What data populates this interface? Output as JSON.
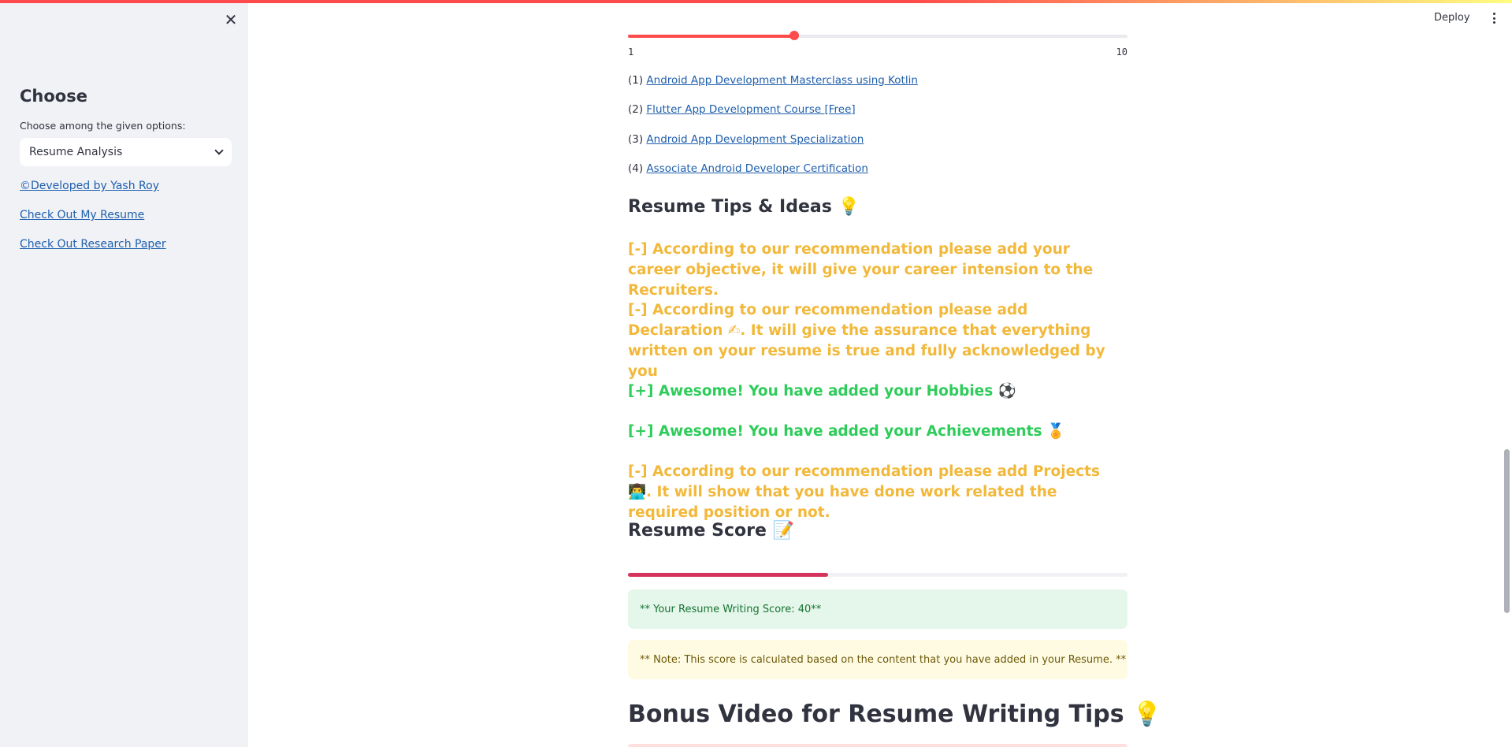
{
  "header": {
    "deploy_label": "Deploy",
    "menu_icon": "kebab-menu-icon"
  },
  "sidebar": {
    "close_icon": "close-icon",
    "heading": "Choose",
    "select_label": "Choose among the given options:",
    "select_value": "Resume Analysis",
    "links": [
      "©Developed by Yash Roy",
      "Check Out My Resume",
      "Check Out Research Paper"
    ]
  },
  "slider": {
    "min_label": "1",
    "max_label": "10",
    "value": 4,
    "min": 1,
    "max": 10
  },
  "courses": [
    {
      "index": "(1)",
      "title": "Android App Development Masterclass using Kotlin"
    },
    {
      "index": "(2)",
      "title": "Flutter App Development Course [Free]"
    },
    {
      "index": "(3)",
      "title": "Android App Development Specialization"
    },
    {
      "index": "(4)",
      "title": "Associate Android Developer Certification"
    }
  ],
  "tips_heading": "Resume Tips & Ideas 💡",
  "tips": [
    {
      "kind": "minus",
      "text": "[-] According to our recommendation please add your career objective, it will give your career intension to the Recruiters."
    },
    {
      "kind": "minus",
      "text": "[-] According to our recommendation please add Declaration ✍. It will give the assurance that everything written on your resume is true and fully acknowledged by you"
    },
    {
      "kind": "plus",
      "text": "[+] Awesome! You have added your Hobbies ⚽"
    },
    {
      "kind": "plus",
      "text": "[+] Awesome! You have added your Achievements 🏅"
    },
    {
      "kind": "minus",
      "text": "[-] According to our recommendation please add Projects 👨‍💻. It will show that you have done work related the required position or not."
    }
  ],
  "score_heading": "Resume Score 📝",
  "score_progress": 0.4,
  "score_text": "** Your Resume Writing Score: 40**",
  "note_text": "** Note: This score is calculated based on the content that you have added in your Resume. **",
  "bonus_heading": "Bonus Video for Resume Writing Tips 💡",
  "colors": {
    "accent": "#ff4b4b",
    "tip_minus": "#f2b83a",
    "tip_plus": "#2ecc5a",
    "link": "#1f5fad",
    "progress": "#d5345c"
  }
}
